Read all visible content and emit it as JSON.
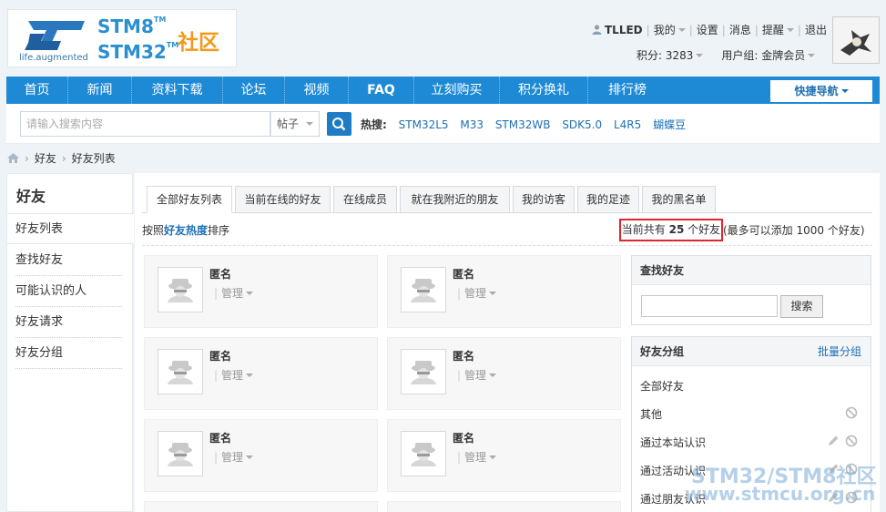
{
  "logo": {
    "tagline": "life.augmented",
    "brand_line1": "STM8",
    "brand_line2": "STM32",
    "tm": "TM",
    "community": "社区"
  },
  "userbar": {
    "username": "TLLED",
    "items": [
      "我的",
      "设置",
      "消息",
      "提醒",
      "退出"
    ],
    "points": "积分: 3283",
    "usergroup": "用户组: 金牌会员"
  },
  "nav": {
    "items": [
      "首页",
      "新闻",
      "资料下载",
      "论坛",
      "视频",
      "FAQ",
      "立刻购买",
      "积分换礼",
      "排行榜"
    ],
    "quick_nav": "快捷导航"
  },
  "search": {
    "placeholder": "请输入搜索内容",
    "type": "帖子",
    "hot_label": "热搜:",
    "hot_items": [
      "STM32L5",
      "M33",
      "STM32WB",
      "SDK5.0",
      "L4R5",
      "蝴蝶豆"
    ]
  },
  "breadcrumb": [
    "好友",
    "好友列表"
  ],
  "sidebar": {
    "title": "好友",
    "items": [
      "好友列表",
      "查找好友",
      "可能认识的人",
      "好友请求",
      "好友分组"
    ]
  },
  "tabs": [
    "全部好友列表",
    "当前在线的好友",
    "在线成员",
    "就在我附近的朋友",
    "我的访客",
    "我的足迹",
    "我的黑名单"
  ],
  "sort": {
    "prefix": "按照",
    "highlight": "好友热度",
    "suffix": "排序"
  },
  "count": {
    "prefix": "当前共有",
    "number": "25",
    "suffix": "个好友",
    "limit": "(最多可以添加 1000 个好友)"
  },
  "friends": [
    {
      "name": "匿名",
      "manage": "管理"
    },
    {
      "name": "匿名",
      "manage": "管理"
    },
    {
      "name": "匿名",
      "manage": "管理"
    },
    {
      "name": "匿名",
      "manage": "管理"
    },
    {
      "name": "匿名",
      "manage": "管理"
    },
    {
      "name": "匿名",
      "manage": "管理"
    }
  ],
  "find_panel": {
    "title": "查找好友",
    "button": "搜索"
  },
  "group_panel": {
    "title": "好友分组",
    "link": "批量分组",
    "groups": [
      "全部好友",
      "其他",
      "通过本站认识",
      "通过活动认识",
      "通过朋友认识"
    ]
  },
  "watermark": {
    "line1": "STM32/STM8社区",
    "line2": "www.stmcu.org.cn"
  },
  "colors": {
    "nav_blue": "#1e8ad6",
    "link_blue": "#1e6fb5",
    "highlight_red": "#e0252b",
    "logo_orange": "#f39a1e"
  }
}
